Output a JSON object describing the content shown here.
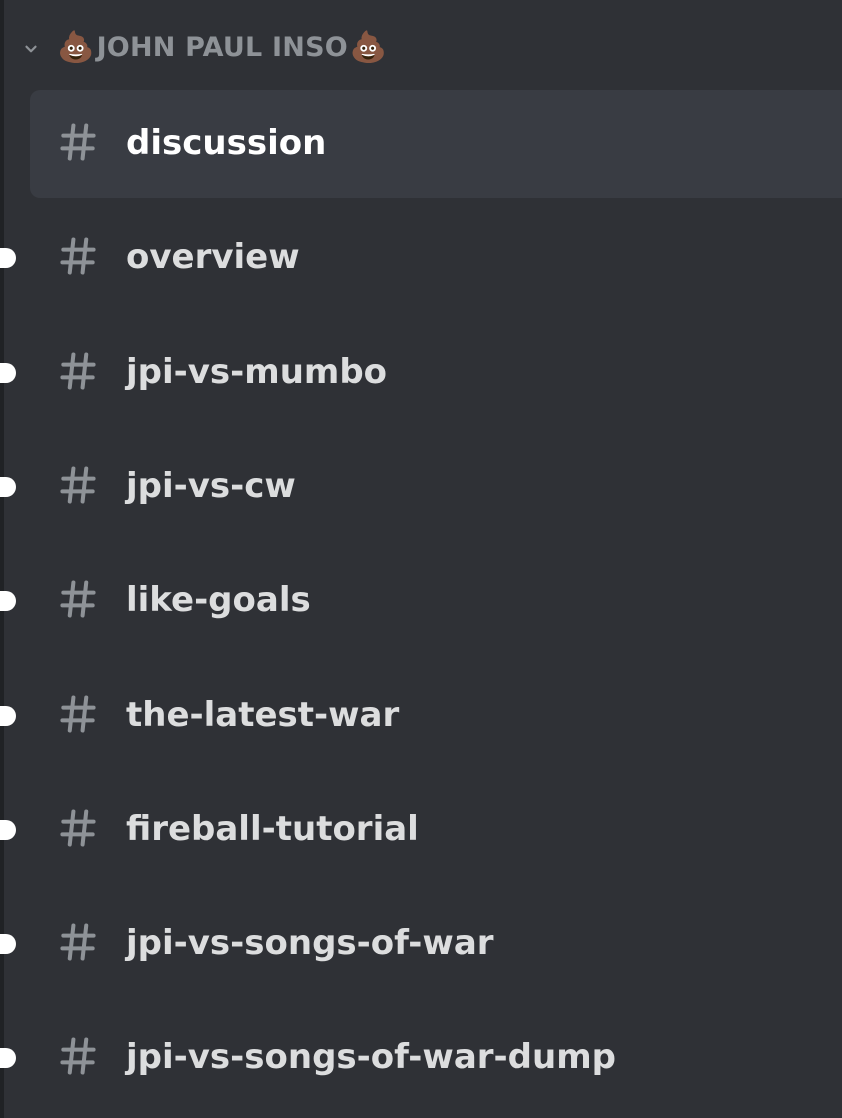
{
  "category": {
    "emoji_left": "💩",
    "name": "JOHN PAUL INSO",
    "emoji_right": "💩",
    "collapsed": false
  },
  "channels": [
    {
      "name": "discussion",
      "selected": true,
      "unread": false
    },
    {
      "name": "overview",
      "selected": false,
      "unread": true
    },
    {
      "name": "jpi-vs-mumbo",
      "selected": false,
      "unread": true
    },
    {
      "name": "jpi-vs-cw",
      "selected": false,
      "unread": true
    },
    {
      "name": "like-goals",
      "selected": false,
      "unread": true
    },
    {
      "name": "the-latest-war",
      "selected": false,
      "unread": true
    },
    {
      "name": "fireball-tutorial",
      "selected": false,
      "unread": true
    },
    {
      "name": "jpi-vs-songs-of-war",
      "selected": false,
      "unread": true
    },
    {
      "name": "jpi-vs-songs-of-war-dump",
      "selected": false,
      "unread": true
    }
  ],
  "icons": {
    "category_toggle": "chevron-down-icon",
    "channel": "text-channel-hash-icon",
    "unread": "unread-indicator"
  },
  "colors": {
    "background": "#2f3136",
    "selected_background": "#393c43",
    "channel_text": "#dcddde",
    "category_text": "#8e9297",
    "hash_icon": "#8e9297",
    "unread_pill": "#ffffff"
  }
}
